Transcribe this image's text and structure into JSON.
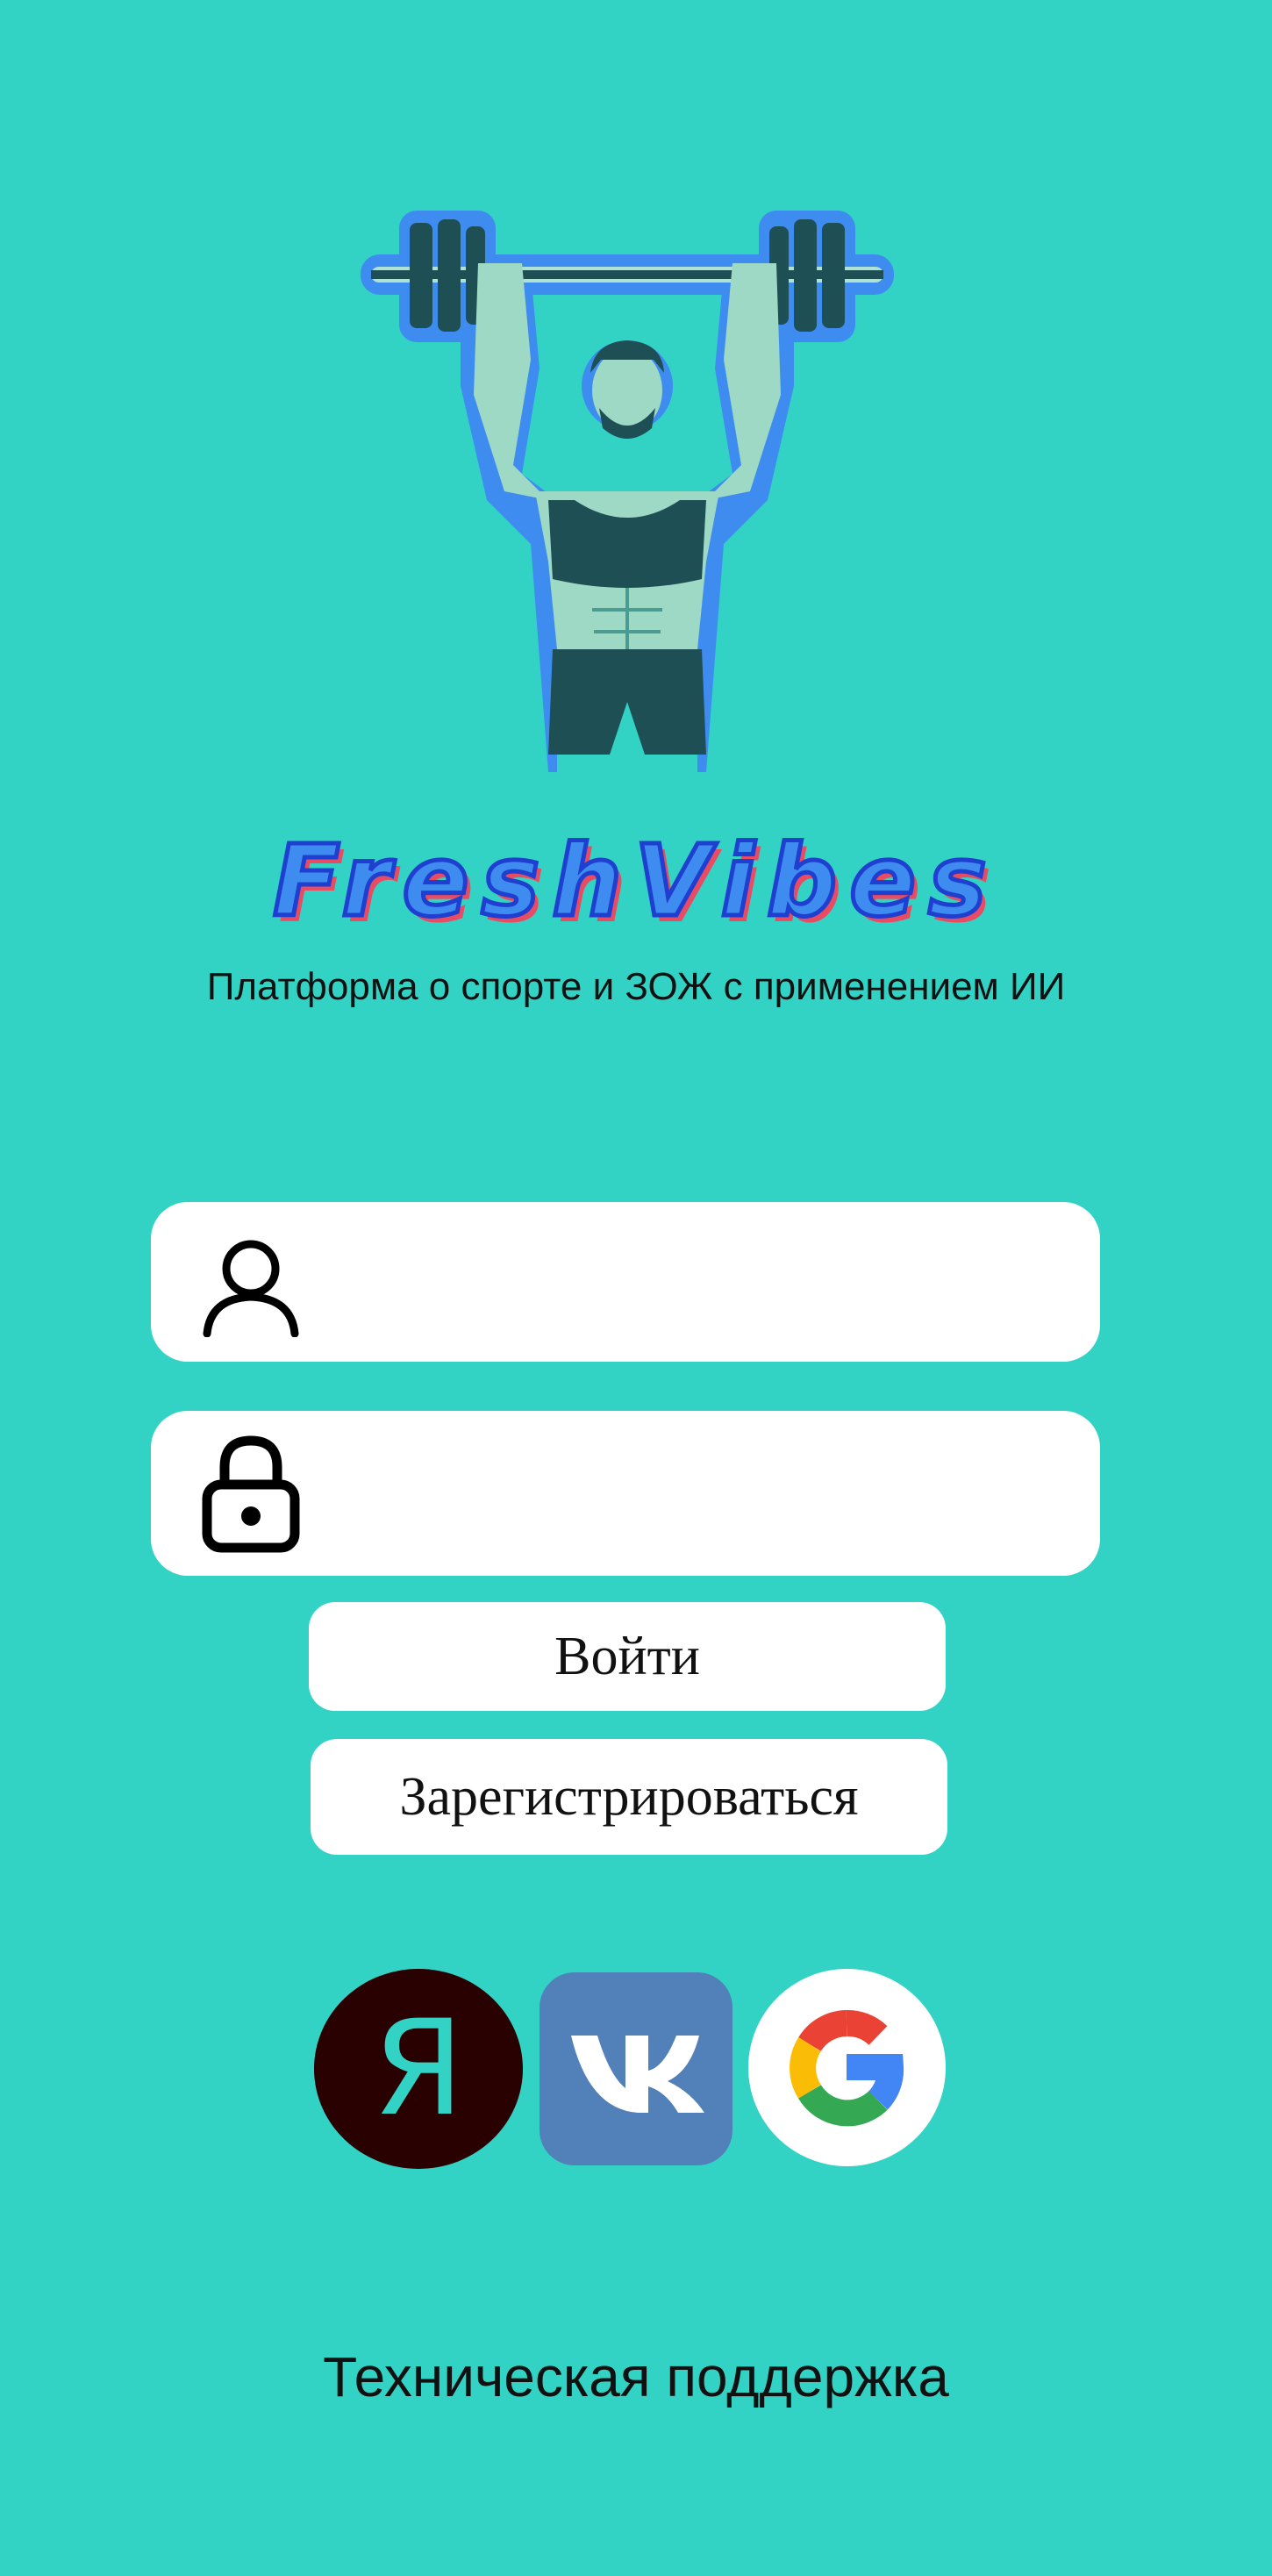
{
  "brand": {
    "name": "FreshVibes",
    "tagline": "Платформа о спорте и ЗОЖ с применением ИИ"
  },
  "login_form": {
    "username": {
      "value": "",
      "placeholder": "",
      "icon": "user-icon"
    },
    "password": {
      "value": "",
      "placeholder": "",
      "icon": "lock-icon"
    },
    "login_label": "Войти",
    "register_label": "Зарегистрироваться"
  },
  "social_login": {
    "yandex": {
      "letter": "Я",
      "color": "#2a0101",
      "icon": "yandex-icon"
    },
    "vk": {
      "color": "#5181b8",
      "icon": "vk-icon"
    },
    "google": {
      "icon": "google-icon"
    }
  },
  "support_label": "Техническая поддержка",
  "colors": {
    "background": "#32d3c4",
    "wordmark": "#3f8cf0",
    "wordmark_shadow": "#e94b62"
  }
}
